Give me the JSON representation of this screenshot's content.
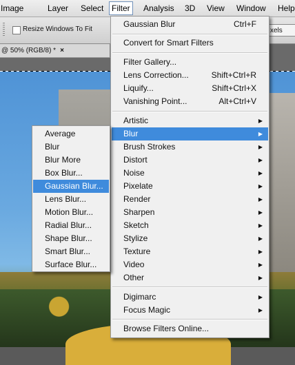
{
  "menubar": {
    "items": [
      "Image",
      "Layer",
      "Select",
      "Filter",
      "Analysis",
      "3D",
      "View",
      "Window",
      "Help"
    ],
    "active": "Filter"
  },
  "options_bar": {
    "checkbox_label": "Resize Windows To Fit",
    "fragment_text": "xels"
  },
  "document_tab": {
    "label": "@ 50% (RGB/8) *",
    "close": "×"
  },
  "filter_menu": {
    "last_filter": {
      "label": "Gaussian Blur",
      "shortcut": "Ctrl+F"
    },
    "convert": {
      "label": "Convert for Smart Filters"
    },
    "group2": [
      {
        "label": "Filter Gallery..."
      },
      {
        "label": "Lens Correction...",
        "shortcut": "Shift+Ctrl+R"
      },
      {
        "label": "Liquify...",
        "shortcut": "Shift+Ctrl+X"
      },
      {
        "label": "Vanishing Point...",
        "shortcut": "Alt+Ctrl+V"
      }
    ],
    "submenus": [
      "Artistic",
      "Blur",
      "Brush Strokes",
      "Distort",
      "Noise",
      "Pixelate",
      "Render",
      "Sharpen",
      "Sketch",
      "Stylize",
      "Texture",
      "Video",
      "Other"
    ],
    "highlighted": "Blur",
    "plugins": [
      "Digimarc",
      "Focus Magic"
    ],
    "browse": {
      "label": "Browse Filters Online..."
    }
  },
  "blur_menu": {
    "items": [
      "Average",
      "Blur",
      "Blur More",
      "Box Blur...",
      "Gaussian Blur...",
      "Lens Blur...",
      "Motion Blur...",
      "Radial Blur...",
      "Shape Blur...",
      "Smart Blur...",
      "Surface Blur..."
    ],
    "highlighted": "Gaussian Blur..."
  },
  "colors": {
    "highlight": "#3f8bdc",
    "menu_bg": "#f0f0f0"
  }
}
